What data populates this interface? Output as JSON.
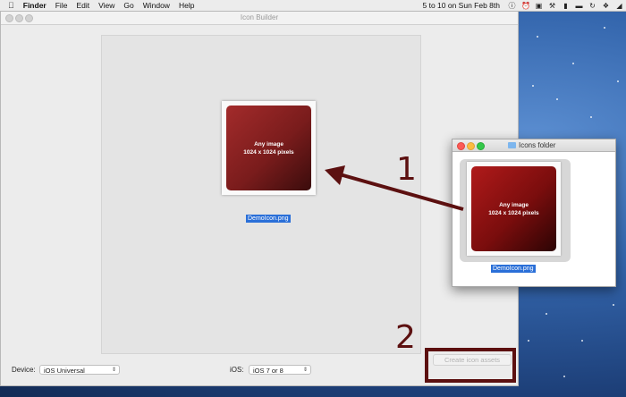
{
  "menubar": {
    "apple_icon": "apple-icon",
    "items": [
      "Finder",
      "File",
      "Edit",
      "View",
      "Go",
      "Window",
      "Help"
    ],
    "clock": "5 to 10 on Sun Feb 8th"
  },
  "main_window": {
    "title": "Icon Builder",
    "file_label": "DemoIcon.png",
    "icon_line1": "Any image",
    "icon_line2": "1024 x 1024 pixels",
    "device_label": "Device:",
    "device_value": "iOS Universal",
    "ios_label": "iOS:",
    "ios_value": "iOS 7 or 8",
    "create_button": "Create icon assets"
  },
  "finder_window": {
    "title": "Icons folder",
    "file_label": "DemoIcon.png",
    "icon_line1": "Any image",
    "icon_line2": "1024 x 1024 pixels"
  },
  "annotations": {
    "step1": "1",
    "step2": "2",
    "color": "#5c1010"
  }
}
